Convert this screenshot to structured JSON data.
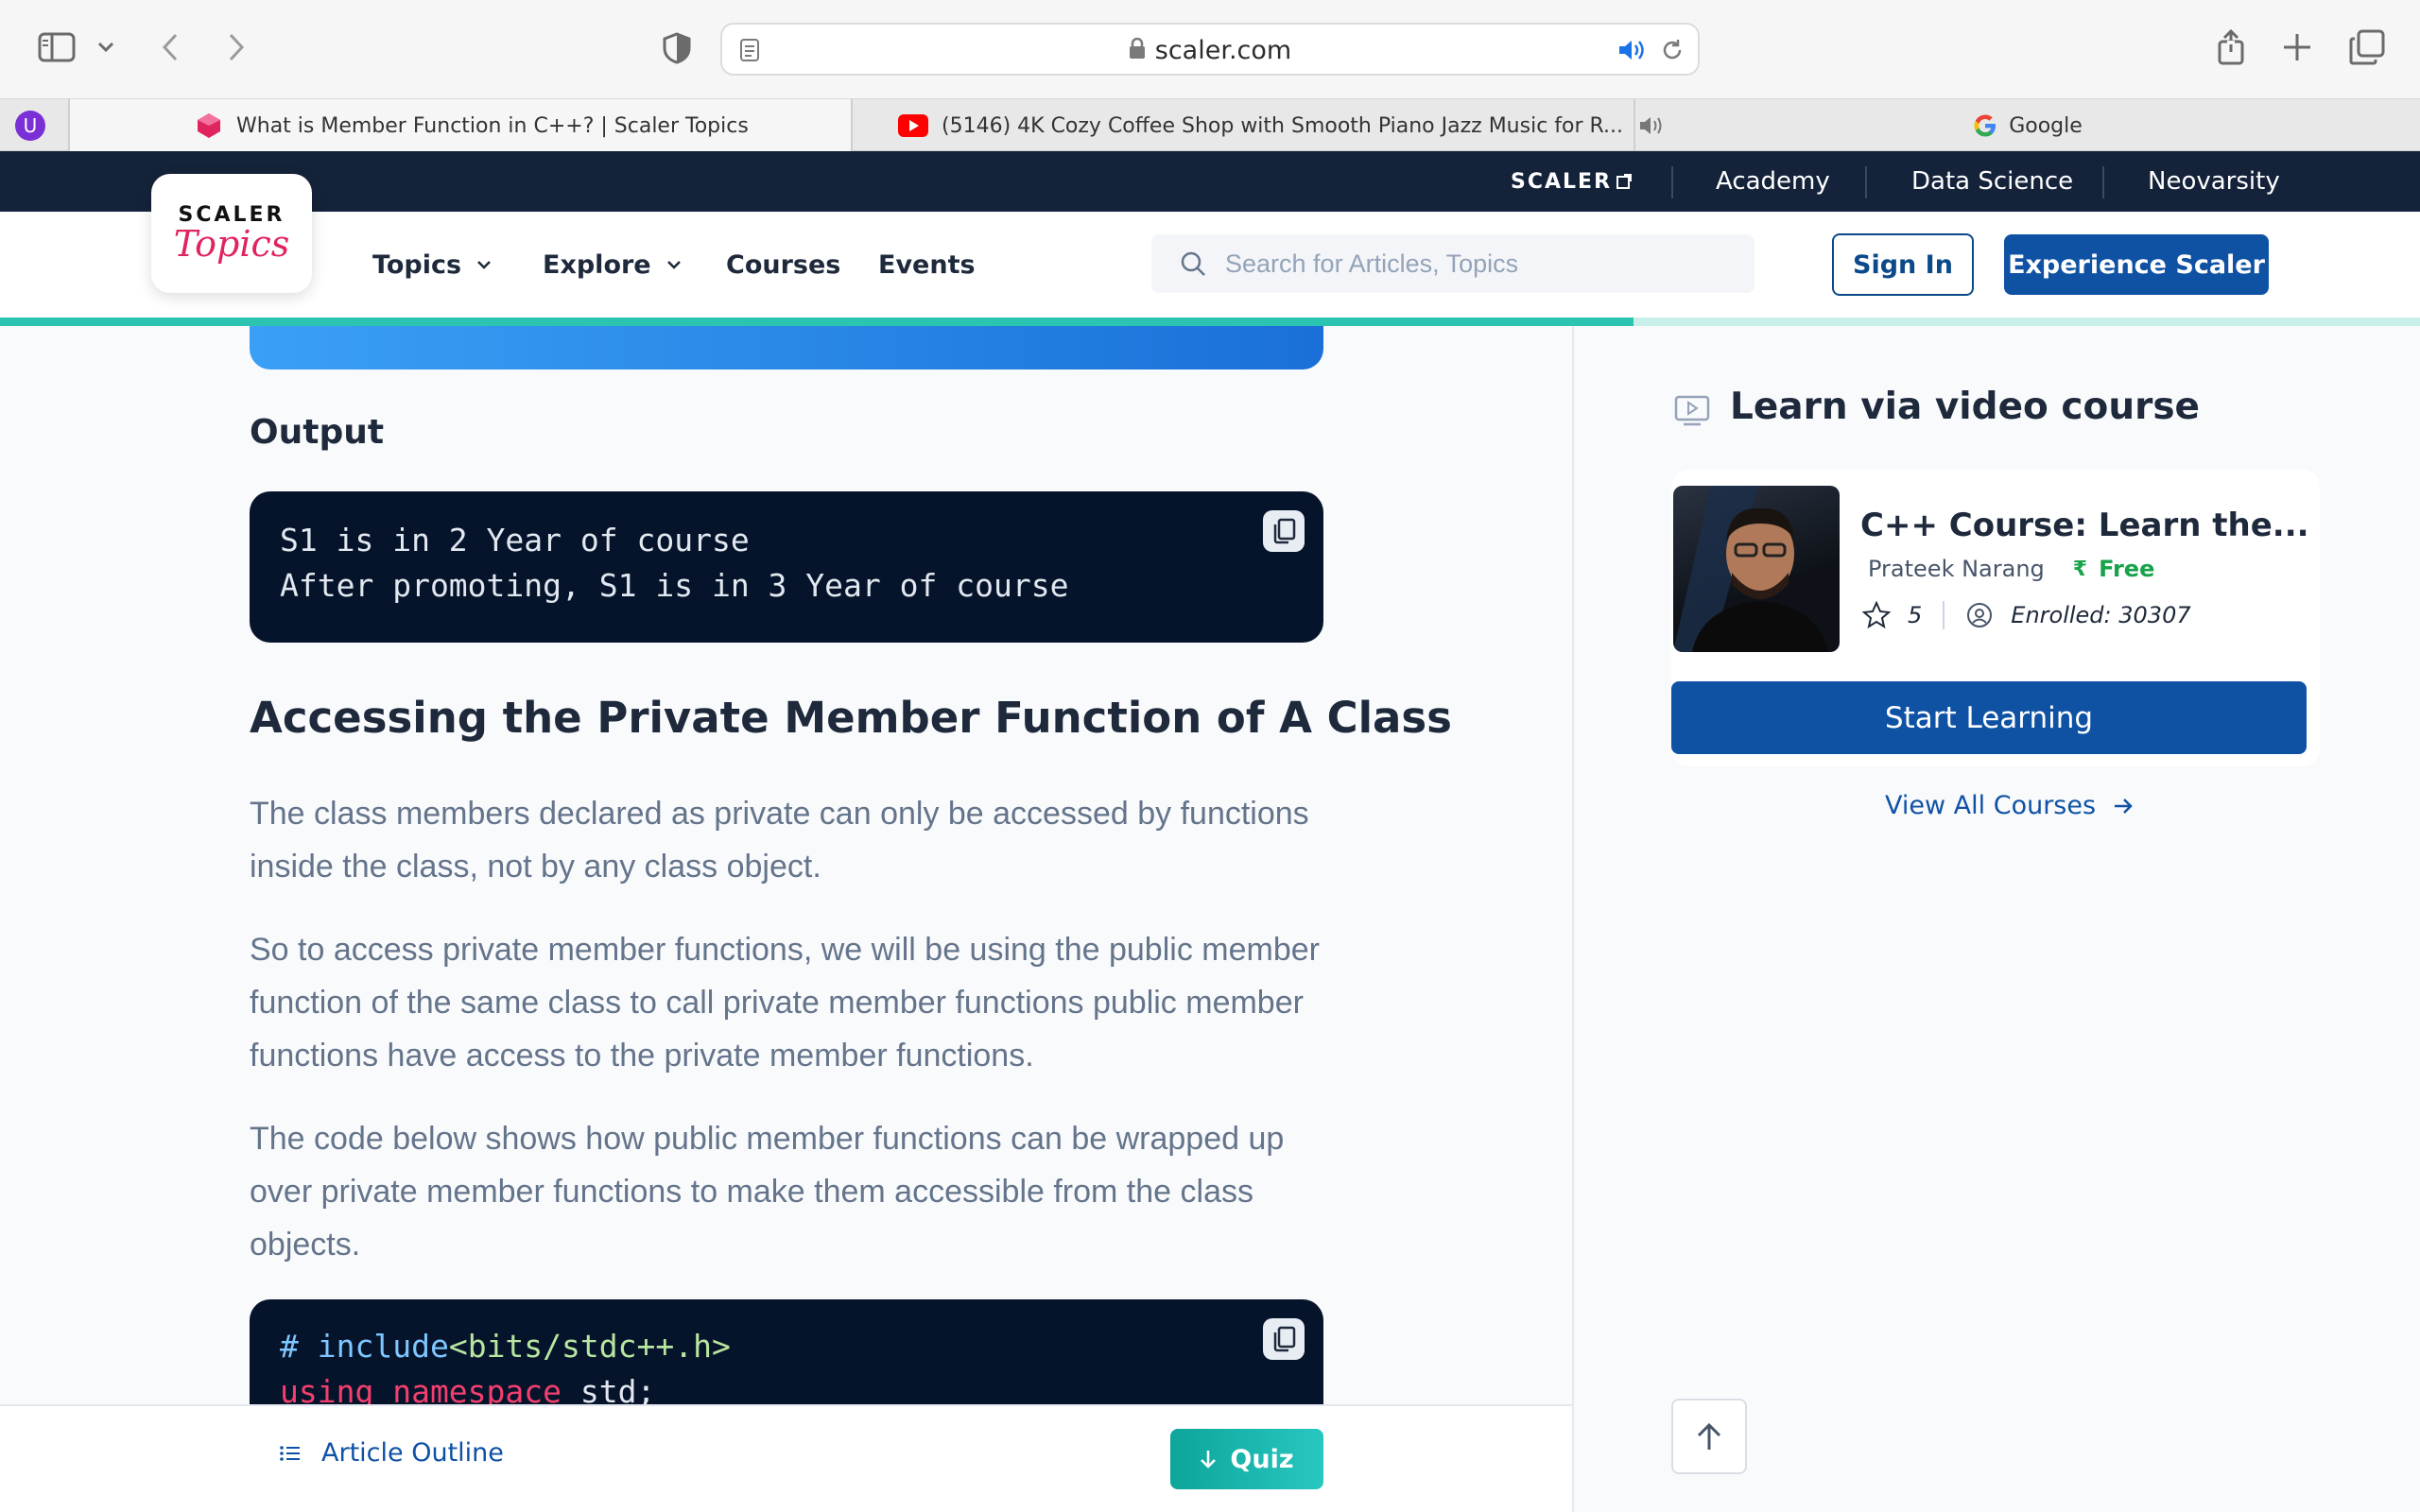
{
  "browser": {
    "url": "scaler.com",
    "tabs": [
      {
        "title": "What is Member Function in C++? | Scaler Topics",
        "active": true
      },
      {
        "title": "(5146) 4K Cozy Coffee Shop with Smooth Piano Jazz Music for R...",
        "active": false
      },
      {
        "title": "Google",
        "active": false
      }
    ]
  },
  "site": {
    "strip": {
      "brand": "SCALER",
      "links": [
        "Academy",
        "Data Science",
        "Neovarsity"
      ]
    },
    "logo": {
      "top": "SCALER",
      "bottom": "Topics"
    },
    "nav": {
      "items": [
        "Topics",
        "Explore",
        "Courses",
        "Events"
      ],
      "search_placeholder": "Search for Articles, Topics",
      "signin_label": "Sign In",
      "experience_label": "Experience Scaler"
    },
    "reading_progress": 0.675
  },
  "article": {
    "output_heading": "Output",
    "output_lines": [
      "S1 is in 2 Year of course",
      "After promoting, S1 is in 3 Year of course"
    ],
    "section_heading": "Accessing the Private Member Function of A Class",
    "paragraphs": [
      "The class members declared as private can only be accessed by functions inside the class, not by any class object.",
      "So to access private member functions, we will be using the public member function of the same class to call private member functions public member functions have access to the private member functions.",
      "The code below shows how public member functions can be wrapped up over private member functions to make them accessible from the class objects."
    ],
    "code": {
      "line1_hash": "# ",
      "line1_include": "include",
      "line1_header": "<bits/stdc++.h>",
      "line2_kw": "using namespace",
      "line2_rest": " std;"
    }
  },
  "bottom_bar": {
    "outline_label": "Article Outline",
    "quiz_label": "Quiz"
  },
  "sidebar": {
    "title": "Learn via video course",
    "course": {
      "title": "C++ Course: Learn the...",
      "instructor": "Prateek Narang",
      "price": "Free",
      "rating": "5",
      "enrolled": "Enrolled: 30307"
    },
    "start_label": "Start Learning",
    "view_all_label": "View All Courses"
  },
  "colors": {
    "brand_blue": "#0f52a4",
    "dark_navy": "#14233a",
    "accent_teal": "#2bc4b0",
    "topics_pink": "#e0245e",
    "free_green": "#16a34a"
  }
}
